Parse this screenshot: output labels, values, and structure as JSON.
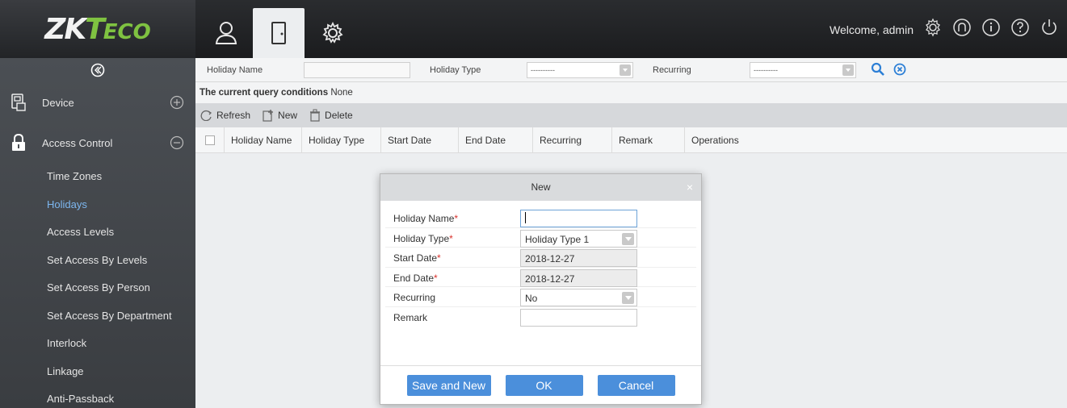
{
  "header": {
    "logo_main": "ZK",
    "logo_t": "T",
    "logo_eco": "ECO",
    "welcome": "Welcome, admin",
    "icons": [
      "user-icon",
      "door-icon",
      "gear-icon",
      "settings-icon",
      "brand-icon",
      "info-icon",
      "help-icon",
      "power-icon"
    ]
  },
  "sidebar": {
    "collapse_icon": "collapse-icon",
    "sections": [
      {
        "label": "Device",
        "icon": "device-icon",
        "expander": "plus-icon"
      },
      {
        "label": "Access Control",
        "icon": "lock-icon",
        "expander": "minus-icon"
      }
    ],
    "items": [
      {
        "label": "Time Zones"
      },
      {
        "label": "Holidays"
      },
      {
        "label": "Access Levels"
      },
      {
        "label": "Set Access By Levels"
      },
      {
        "label": "Set Access By Person"
      },
      {
        "label": "Set Access By Department"
      },
      {
        "label": "Interlock"
      },
      {
        "label": "Linkage"
      },
      {
        "label": "Anti-Passback"
      }
    ],
    "active_item": "Holidays",
    "active_color": "#7db7f0"
  },
  "query": {
    "holiday_name_label": "Holiday Name",
    "holiday_type_label": "Holiday Type",
    "holiday_type_value": "----------",
    "recurring_label": "Recurring",
    "recurring_value": "----------"
  },
  "conditions": {
    "label": "The current query conditions",
    "value": "None"
  },
  "toolbar": {
    "refresh": "Refresh",
    "new": "New",
    "delete": "Delete"
  },
  "table": {
    "columns": [
      "Holiday Name",
      "Holiday Type",
      "Start Date",
      "End Date",
      "Recurring",
      "Remark",
      "Operations"
    ]
  },
  "modal": {
    "title": "New",
    "close": "×",
    "fields": [
      {
        "label": "Holiday Name",
        "required": true,
        "value": ""
      },
      {
        "label": "Holiday Type",
        "required": true,
        "value": "Holiday Type 1"
      },
      {
        "label": "Start Date",
        "required": true,
        "value": "2018-12-27"
      },
      {
        "label": "End Date",
        "required": true,
        "value": "2018-12-27"
      },
      {
        "label": "Recurring",
        "required": false,
        "value": "No"
      },
      {
        "label": "Remark",
        "required": false,
        "value": ""
      }
    ],
    "required_mark": "*",
    "buttons": {
      "save_new": "Save and New",
      "ok": "OK",
      "cancel": "Cancel"
    },
    "button_color": "#4b8fdb"
  }
}
